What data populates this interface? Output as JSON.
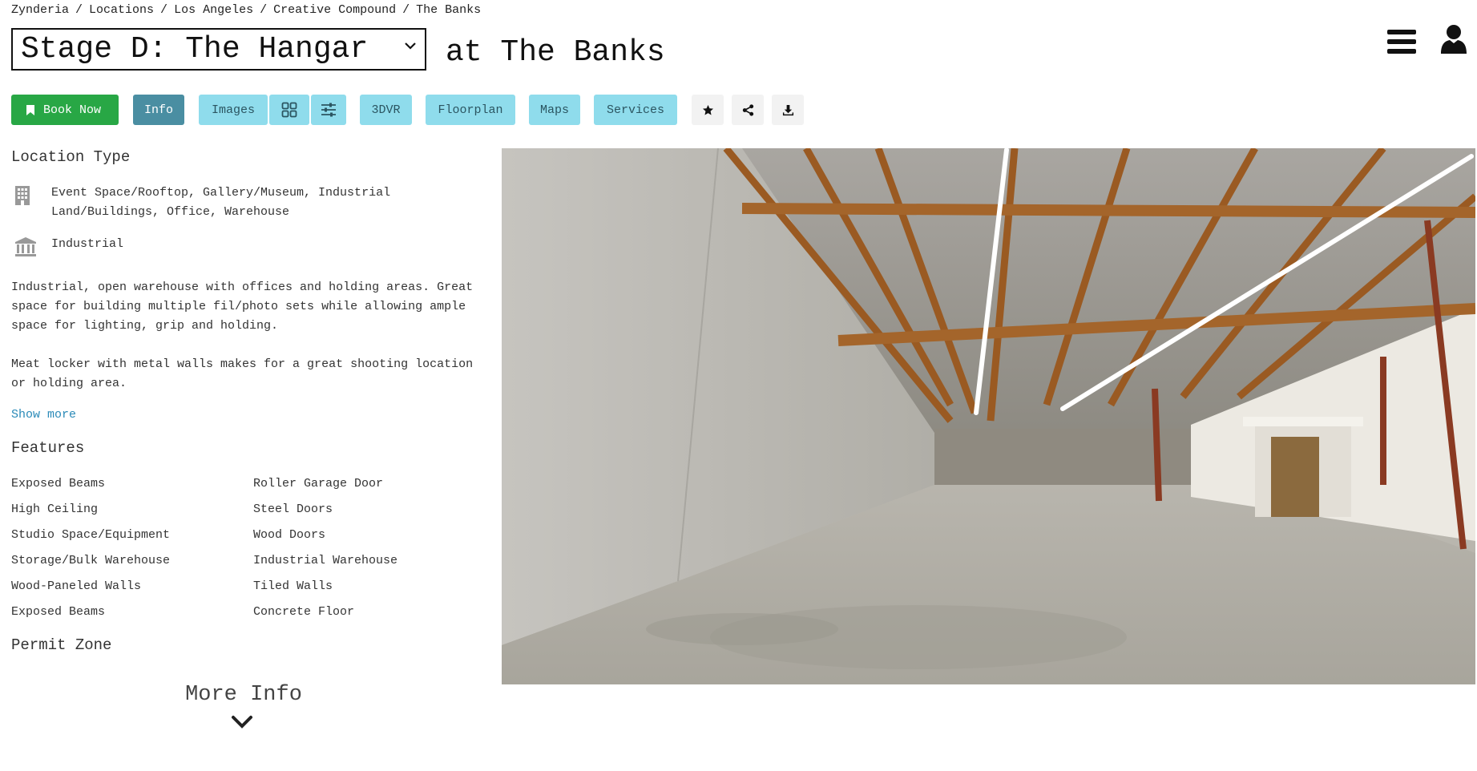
{
  "breadcrumb": {
    "items": [
      "Zynderia",
      "Locations",
      "Los Angeles",
      "Creative Compound",
      "The Banks"
    ],
    "separator": "/"
  },
  "header": {
    "stage_select_value": "Stage D: The Hangar",
    "title_suffix": "at The Banks",
    "menu_icon": "hamburger-menu-icon",
    "user_icon": "user-icon"
  },
  "toolbar": {
    "book_label": "Book Now",
    "info_label": "Info",
    "images_label": "Images",
    "vr_label": "3DVR",
    "floorplan_label": "Floorplan",
    "maps_label": "Maps",
    "services_label": "Services",
    "colors": {
      "book": "#28a745",
      "info_active": "#4a8ea2",
      "tab": "#8fdcec"
    }
  },
  "location_type": {
    "title": "Location Type",
    "categories": "Event Space/Rooftop, Gallery/Museum, Industrial Land/Buildings, Office, Warehouse",
    "category_icon": "building-icon",
    "style": "Industrial",
    "style_icon": "institution-icon"
  },
  "description": {
    "p1": "Industrial, open warehouse with offices and holding areas. Great space for building multiple fil/photo sets while allowing ample space for lighting, grip and holding.",
    "p2": "Meat locker with metal walls makes for a great shooting location or holding area.",
    "show_more": "Show more"
  },
  "features": {
    "title": "Features",
    "items": [
      "Exposed Beams",
      "Roller Garage Door",
      "High Ceiling",
      "Steel Doors",
      "Studio Space/Equipment",
      "Wood Doors",
      "Storage/Bulk Warehouse",
      "Industrial Warehouse",
      "Wood-Paneled Walls",
      "Tiled Walls",
      "Exposed Beams",
      "Concrete Floor"
    ]
  },
  "permit": {
    "title": "Permit Zone"
  },
  "more_info": {
    "label": "More Info"
  }
}
